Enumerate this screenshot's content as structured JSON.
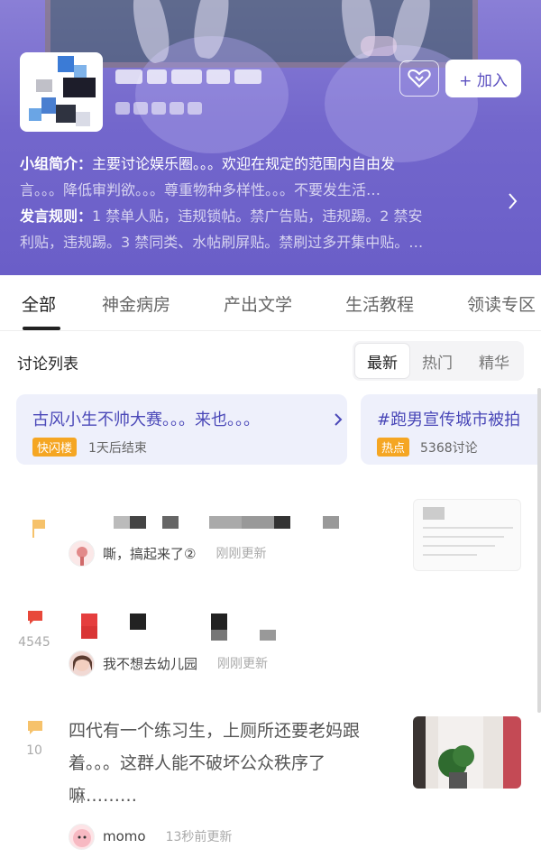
{
  "group": {
    "join_label": "+ 加入",
    "intro_label": "小组简介：",
    "intro_text_1": "主要讨论娱乐圈。。。欢迎在规定的范围内自由发",
    "intro_text_2": "言。。。降低审判欲。。。尊重物种多样性。。。不要发生活…",
    "rules_label": "发言规则：",
    "rules_text_1": "1 禁单人贴，违规锁帖。禁广告贴，违规踢。2 禁安",
    "rules_text_2": "利贴，违规踢。3 禁同类、水帖刷屏贴。禁刷过多开集中贴。…"
  },
  "tabs": [
    "全部",
    "神金病房",
    "产出文学",
    "生活教程",
    "领读专区"
  ],
  "discussion": {
    "title": "讨论列表",
    "sort": [
      "最新",
      "热门",
      "精华"
    ]
  },
  "topics": [
    {
      "title": "古风小生不帅大赛。。。来也。。。",
      "tag": "快闪楼",
      "meta": "1天后结束"
    },
    {
      "title": "#跑男宣传城市被拍",
      "tag": "热点",
      "meta": "5368讨论"
    }
  ],
  "posts": [
    {
      "count": "",
      "user": "嘶，搞起来了②",
      "time": "刚刚更新",
      "icon_color": "#f6c26b"
    },
    {
      "count": "4545",
      "user": "我不想去幼儿园",
      "time": "刚刚更新",
      "icon_color": "#e8483a"
    },
    {
      "count": "10",
      "text": "四代有一个练习生，上厕所还要老妈跟着。。。这群人能不破坏公众秩序了嘛………",
      "user": "momo",
      "time": "13秒前更新",
      "icon_color": "#f6c26b"
    }
  ]
}
